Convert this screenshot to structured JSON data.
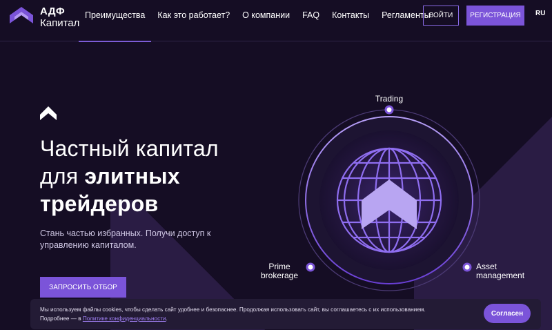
{
  "brand": {
    "line1": "АДФ",
    "line2": "Капитал",
    "accent_color": "#7b54d9"
  },
  "nav": {
    "items": [
      {
        "label": "Преимущества",
        "active": true
      },
      {
        "label": "Как это работает?",
        "active": false
      },
      {
        "label": "О компании",
        "active": false
      },
      {
        "label": "FAQ",
        "active": false
      },
      {
        "label": "Контакты",
        "active": false
      },
      {
        "label": "Регламенты",
        "active": false
      }
    ],
    "login_label": "ВОЙТИ",
    "register_label": "РЕГИСТРАЦИЯ",
    "language": "RU"
  },
  "hero": {
    "title_line1": "Частный капитал",
    "title_line2_plain": "для ",
    "title_line2_bold": "элитных",
    "title_line3_bold": "трейдеров",
    "subtitle": "Стань частью избранных. Получи доступ к управлению капиталом.",
    "cta_label": "ЗАПРОСИТЬ ОТБОР"
  },
  "diagram": {
    "labels": {
      "top": "Trading",
      "left_line1": "Prime",
      "left_line2": "brokerage",
      "right_line1": "Asset",
      "right_line2": "management"
    }
  },
  "cookie": {
    "text_main": "Мы используем файлы cookies, чтобы сделать сайт удобнее и безопаснее. Продолжая использовать сайт, вы соглашаетесь с их использованием.",
    "text_more": "Подробнее — в ",
    "link_label": "Политике конфиденциальности",
    "text_end": ".",
    "accept_label": "Согласен"
  }
}
